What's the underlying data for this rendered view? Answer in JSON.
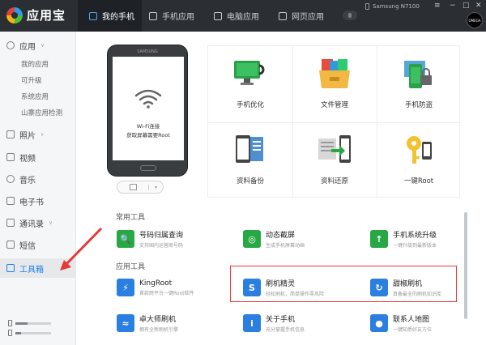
{
  "app": {
    "name": "应用宝"
  },
  "tabs": [
    {
      "label": "我的手机"
    },
    {
      "label": "手机应用"
    },
    {
      "label": "电脑应用"
    },
    {
      "label": "网页应用"
    }
  ],
  "device": {
    "name": "Samsung N7100",
    "badge": "OMEGA"
  },
  "window": {
    "menu": "≡",
    "minimize": "−",
    "maximize": "□",
    "close": "✕"
  },
  "sidebar": {
    "apps": {
      "label": "应用",
      "chevron": "∨",
      "subs": [
        "我的应用",
        "可升级",
        "系统应用",
        "山寨应用检测"
      ]
    },
    "items": [
      {
        "label": "照片",
        "chevron": "›"
      },
      {
        "label": "视频"
      },
      {
        "label": "音乐"
      },
      {
        "label": "电子书"
      },
      {
        "label": "通讯录",
        "chevron": "∨"
      },
      {
        "label": "短信"
      },
      {
        "label": "工具箱"
      }
    ],
    "storage": [
      {
        "fill": 0.35
      },
      {
        "fill": 0.15
      }
    ]
  },
  "phone": {
    "brand": "SAMSUNG",
    "line1": "Wi-Fi连接",
    "line2": "获取屏幕需要Root",
    "screenshot_caret": "▾"
  },
  "grid": [
    {
      "label": "手机优化",
      "icon": "phone-optimize-icon"
    },
    {
      "label": "文件管理",
      "icon": "file-manager-icon"
    },
    {
      "label": "手机防盗",
      "icon": "anti-theft-icon"
    },
    {
      "label": "资料备份",
      "icon": "backup-icon"
    },
    {
      "label": "资料还原",
      "icon": "restore-icon"
    },
    {
      "label": "一键Root",
      "icon": "root-key-icon"
    }
  ],
  "sections": {
    "common": "常用工具",
    "apps": "应用工具"
  },
  "tools": [
    {
      "name": "号码归属查询",
      "desc": "支持国内运营商号码",
      "icon": "number-lookup-icon",
      "color": "#27a845",
      "glyph": "🔍"
    },
    {
      "name": "动态截屏",
      "desc": "生成手机屏幕动画",
      "icon": "dynamic-screenshot-icon",
      "color": "#27a845",
      "glyph": "◎"
    },
    {
      "name": "手机系统升级",
      "desc": "一键升级到最新版本",
      "icon": "system-upgrade-icon",
      "color": "#27a845",
      "glyph": "↑"
    },
    {
      "name": "KingRoot",
      "desc": "首款跨平台一键Root软件",
      "icon": "kingroot-icon",
      "color": "#2b7fe0",
      "glyph": "⚡"
    },
    {
      "name": "刷机精灵",
      "desc": "轻松刷机，简单操作零风险",
      "icon": "flash-wizard-icon",
      "color": "#2b7fe0",
      "glyph": "S"
    },
    {
      "name": "甜椒刷机",
      "desc": "真备最全的刷机知识库",
      "icon": "tianjiao-flash-icon",
      "color": "#2b7fe0",
      "glyph": "↻"
    },
    {
      "name": "卓大师刷机",
      "desc": "拥有全新刷机引擎",
      "icon": "zhuodashi-icon",
      "color": "#2b7fe0",
      "glyph": "≈"
    },
    {
      "name": "关于手机",
      "desc": "充分掌握手机信息",
      "icon": "about-phone-icon",
      "color": "#2b7fe0",
      "glyph": "i"
    },
    {
      "name": "联系人地图",
      "desc": "一键知悉好友方位",
      "icon": "contact-map-icon",
      "color": "#2b7fe0",
      "glyph": "●"
    }
  ]
}
